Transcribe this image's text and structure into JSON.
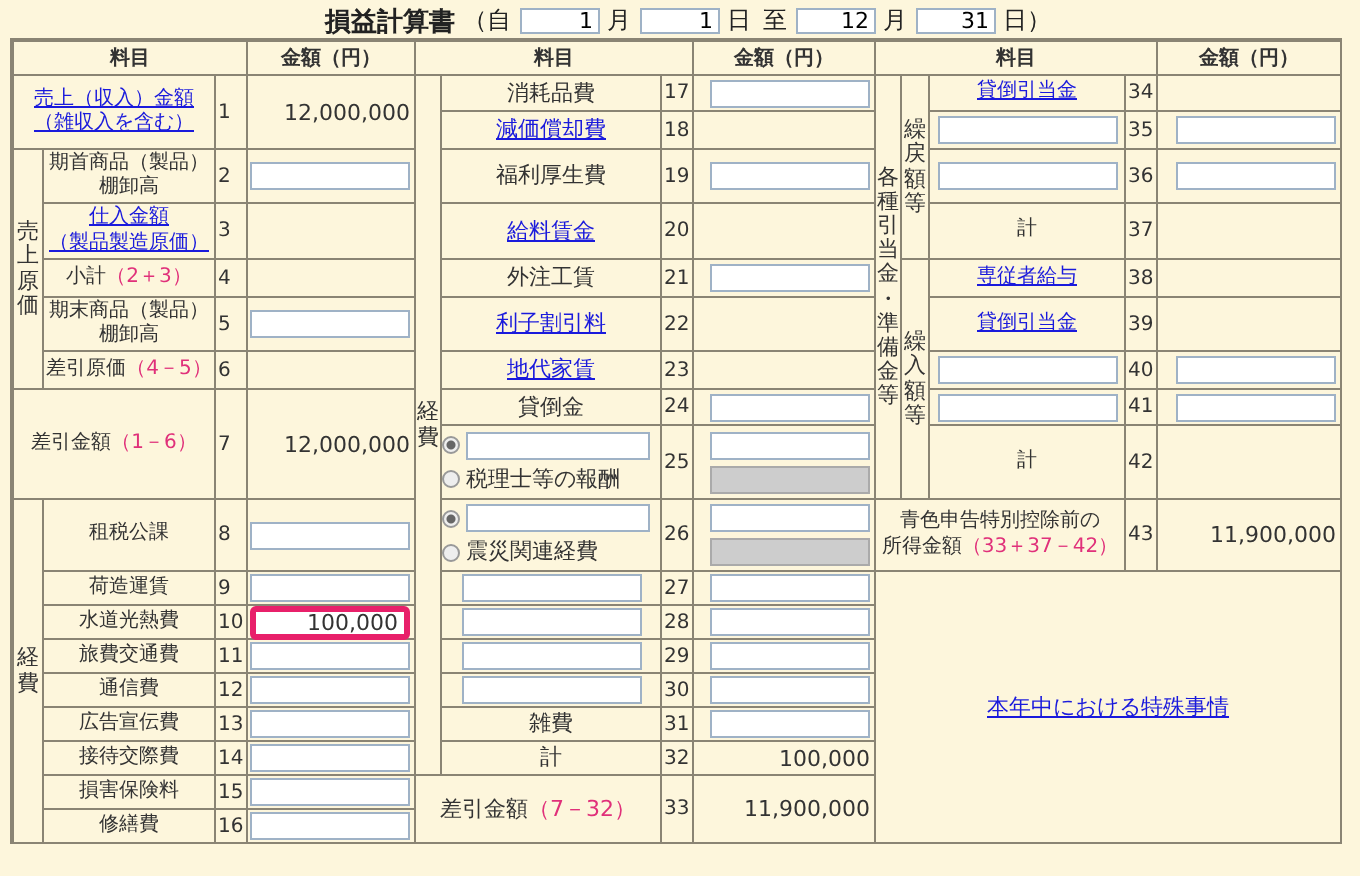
{
  "title": "損益計算書",
  "period": [
    {
      "kind": "text",
      "text": "（自"
    },
    {
      "kind": "field",
      "value": "1"
    },
    {
      "kind": "text",
      "text": "月"
    },
    {
      "kind": "field",
      "value": "1"
    },
    {
      "kind": "text",
      "text": "日"
    },
    {
      "kind": "text",
      "text": "至"
    },
    {
      "kind": "field",
      "value": "12"
    },
    {
      "kind": "text",
      "text": "月"
    },
    {
      "kind": "field",
      "value": "31"
    },
    {
      "kind": "text",
      "text": "日）"
    }
  ],
  "columns": [
    "料目",
    "金額（円）",
    "料目",
    "金額（円）",
    "料目",
    "金額（円）"
  ],
  "left": {
    "groups": [
      "売上原価",
      "経費"
    ],
    "rows": [
      {
        "no": "1",
        "label": {
          "kind": "link",
          "lines": [
            "売上（収入）金額",
            "（雑収入を含む）"
          ]
        },
        "amount": {
          "kind": "value",
          "text": "12,000,000"
        }
      },
      {
        "no": "2",
        "label": {
          "kind": "text",
          "lines": [
            "期首商品（製品）",
            "棚卸高"
          ]
        },
        "amount": {
          "kind": "field",
          "highlighted": false
        }
      },
      {
        "no": "3",
        "label": {
          "kind": "link",
          "lines": [
            "仕入金額",
            "（製品製造原価）"
          ]
        }
      },
      {
        "no": "4",
        "label": {
          "kind": "text",
          "lines": [
            "小計"
          ],
          "formula": "（2＋3）"
        }
      },
      {
        "no": "5",
        "label": {
          "kind": "text",
          "lines": [
            "期末商品（製品）",
            "棚卸高"
          ]
        },
        "amount": {
          "kind": "field",
          "highlighted": false
        }
      },
      {
        "no": "6",
        "label": {
          "kind": "text",
          "lines": [
            "差引原価"
          ],
          "formula": "（4－5）"
        }
      },
      {
        "no": "7",
        "label": {
          "kind": "text",
          "lines": [
            "差引金額"
          ],
          "formula": "（1－6）"
        },
        "amount": {
          "kind": "value",
          "text": "12,000,000"
        }
      },
      {
        "no": "8",
        "label": {
          "kind": "text",
          "lines": [
            "租税公課"
          ]
        },
        "amount": {
          "kind": "field",
          "highlighted": false
        }
      },
      {
        "no": "9",
        "label": {
          "kind": "text",
          "lines": [
            "荷造運賃"
          ]
        },
        "amount": {
          "kind": "field",
          "highlighted": false
        }
      },
      {
        "no": "10",
        "label": {
          "kind": "text",
          "lines": [
            "水道光熱費"
          ]
        },
        "amount": {
          "kind": "field",
          "value": "100,000",
          "highlighted": true
        }
      },
      {
        "no": "11",
        "label": {
          "kind": "text",
          "lines": [
            "旅費交通費"
          ]
        },
        "amount": {
          "kind": "field",
          "highlighted": false
        }
      },
      {
        "no": "12",
        "label": {
          "kind": "text",
          "lines": [
            "通信費"
          ]
        },
        "amount": {
          "kind": "field",
          "highlighted": false
        }
      },
      {
        "no": "13",
        "label": {
          "kind": "text",
          "lines": [
            "広告宣伝費"
          ]
        },
        "amount": {
          "kind": "field",
          "highlighted": false
        }
      },
      {
        "no": "14",
        "label": {
          "kind": "text",
          "lines": [
            "接待交際費"
          ]
        },
        "amount": {
          "kind": "field",
          "highlighted": false
        }
      },
      {
        "no": "15",
        "label": {
          "kind": "text",
          "lines": [
            "損害保険料"
          ]
        },
        "amount": {
          "kind": "field",
          "highlighted": false
        }
      },
      {
        "no": "16",
        "label": {
          "kind": "text",
          "lines": [
            "修繕費"
          ]
        },
        "amount": {
          "kind": "field",
          "highlighted": false
        }
      }
    ]
  },
  "middle": {
    "group": "経費",
    "rows": [
      {
        "no": "17",
        "label": {
          "kind": "text",
          "lines": [
            "消耗品費"
          ]
        },
        "amount": {
          "kind": "field",
          "highlighted": false
        }
      },
      {
        "no": "18",
        "label": {
          "kind": "link",
          "lines": [
            "減価償却費"
          ]
        }
      },
      {
        "no": "19",
        "label": {
          "kind": "text",
          "lines": [
            "福利厚生費"
          ]
        },
        "amount": {
          "kind": "field",
          "highlighted": false
        }
      },
      {
        "no": "20",
        "label": {
          "kind": "link",
          "lines": [
            "給料賃金"
          ]
        }
      },
      {
        "no": "21",
        "label": {
          "kind": "text",
          "lines": [
            "外注工賃"
          ]
        },
        "amount": {
          "kind": "field",
          "highlighted": false
        }
      },
      {
        "no": "22",
        "label": {
          "kind": "link",
          "lines": [
            "利子割引料"
          ]
        }
      },
      {
        "no": "23",
        "label": {
          "kind": "link",
          "lines": [
            "地代家賃"
          ]
        }
      },
      {
        "no": "24",
        "label": {
          "kind": "text",
          "lines": [
            "貸倒金"
          ]
        },
        "amount": {
          "kind": "field",
          "highlighted": false
        }
      },
      {
        "no": "25",
        "label": {
          "kind": "choice",
          "options": [
            {
              "kind": "field",
              "selected": true
            },
            {
              "kind": "text",
              "text": "税理士等の報酬",
              "selected": false
            }
          ]
        },
        "amount": {
          "kind": "pair",
          "fields": [
            {
              "disabled": false
            },
            {
              "disabled": true
            }
          ]
        }
      },
      {
        "no": "26",
        "label": {
          "kind": "choice",
          "options": [
            {
              "kind": "field",
              "selected": true
            },
            {
              "kind": "text",
              "text": "震災関連経費",
              "selected": false
            }
          ]
        },
        "amount": {
          "kind": "pair",
          "fields": [
            {
              "disabled": false
            },
            {
              "disabled": true
            }
          ]
        }
      },
      {
        "no": "27",
        "label": {
          "kind": "field"
        },
        "amount": {
          "kind": "field",
          "highlighted": false
        }
      },
      {
        "no": "28",
        "label": {
          "kind": "field"
        },
        "amount": {
          "kind": "field",
          "highlighted": false
        }
      },
      {
        "no": "29",
        "label": {
          "kind": "field"
        },
        "amount": {
          "kind": "field",
          "highlighted": false
        }
      },
      {
        "no": "30",
        "label": {
          "kind": "field"
        },
        "amount": {
          "kind": "field",
          "highlighted": false
        }
      },
      {
        "no": "31",
        "label": {
          "kind": "text",
          "lines": [
            "雑費"
          ]
        },
        "amount": {
          "kind": "field",
          "highlighted": false
        }
      },
      {
        "no": "32",
        "label": {
          "kind": "text",
          "lines": [
            "計"
          ]
        },
        "amount": {
          "kind": "value",
          "text": "100,000"
        }
      },
      {
        "no": "33",
        "label": {
          "kind": "text",
          "lines": [
            "差引金額"
          ],
          "formula": "（7－32）"
        },
        "amount": {
          "kind": "value",
          "text": "11,900,000"
        }
      }
    ]
  },
  "right": {
    "outer_group": "各種引当金・準備金等",
    "inner_groups": [
      "繰戻額等",
      "繰入額等"
    ],
    "note_link": "本年中における特殊事情",
    "rows": [
      {
        "no": "34",
        "label": {
          "kind": "link",
          "lines": [
            "貸倒引当金"
          ]
        }
      },
      {
        "no": "35",
        "label": {
          "kind": "field"
        },
        "amount": {
          "kind": "field",
          "highlighted": false
        }
      },
      {
        "no": "36",
        "label": {
          "kind": "field"
        },
        "amount": {
          "kind": "field",
          "highlighted": false
        }
      },
      {
        "no": "37",
        "label": {
          "kind": "text",
          "lines": [
            "計"
          ]
        }
      },
      {
        "no": "38",
        "label": {
          "kind": "link",
          "lines": [
            "専従者給与"
          ]
        }
      },
      {
        "no": "39",
        "label": {
          "kind": "link",
          "lines": [
            "貸倒引当金"
          ]
        }
      },
      {
        "no": "40",
        "label": {
          "kind": "field"
        },
        "amount": {
          "kind": "field",
          "highlighted": false
        }
      },
      {
        "no": "41",
        "label": {
          "kind": "field"
        },
        "amount": {
          "kind": "field",
          "highlighted": false
        }
      },
      {
        "no": "42",
        "label": {
          "kind": "text",
          "lines": [
            "計"
          ]
        }
      },
      {
        "no": "43",
        "label": {
          "kind": "text",
          "lines": [
            "青色申告特別控除前の",
            "所得金額"
          ],
          "formula": "（33＋37－42）"
        },
        "amount": {
          "kind": "value",
          "text": "11,900,000"
        }
      }
    ]
  }
}
